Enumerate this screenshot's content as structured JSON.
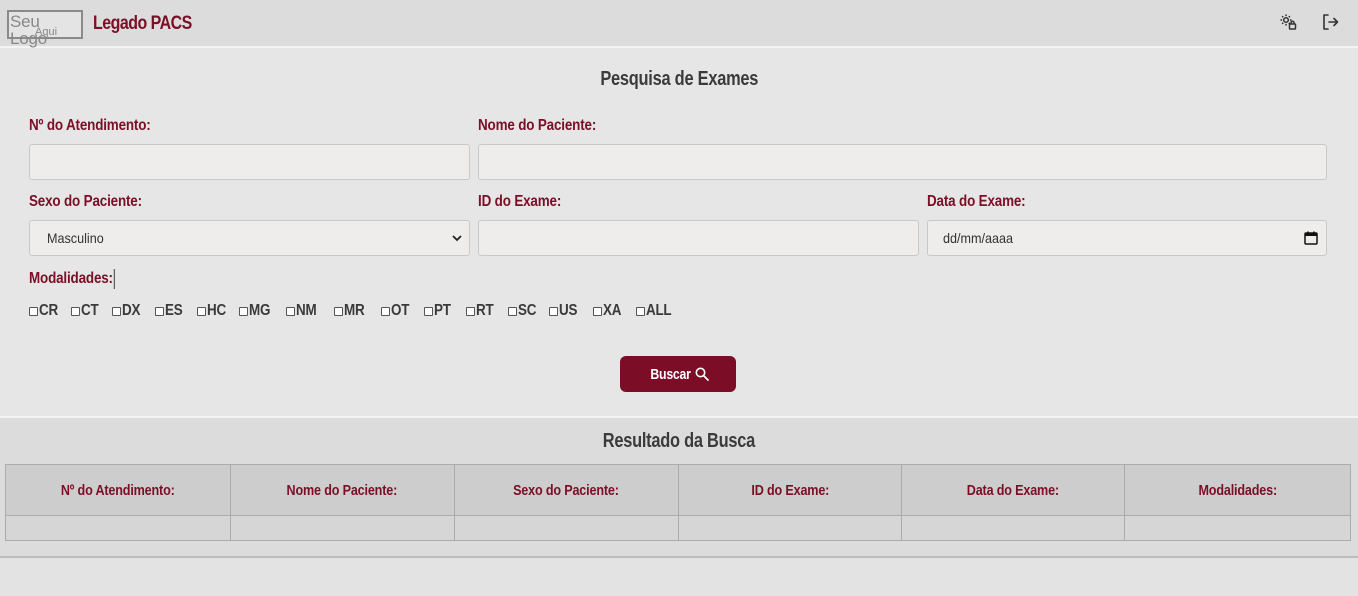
{
  "header": {
    "logo_line1": "Seu Logo",
    "logo_line2": "Aqui",
    "app_title": "Legado PACS",
    "settings_icon": "user-settings-icon",
    "logout_icon": "logout-icon"
  },
  "search": {
    "title": "Pesquisa de Exames",
    "atendimento_label": "Nº do Atendimento:",
    "atendimento_value": "",
    "nome_label": "Nome do Paciente:",
    "nome_value": "",
    "sexo_label": "Sexo do Paciente:",
    "sexo_selected": "Masculino",
    "id_label": "ID do Exame:",
    "id_value": "",
    "data_label": "Data do Exame:",
    "data_placeholder": "dd/mm/aaaa",
    "modalidades_label": "Modalidades:",
    "modalidades": [
      "CR",
      "CT",
      "DX",
      "ES",
      "HC",
      "MG",
      "NM",
      "MR",
      "OT",
      "PT",
      "RT",
      "SC",
      "US",
      "XA",
      "ALL"
    ],
    "button_label": "Buscar"
  },
  "results": {
    "title": "Resultado da Busca",
    "columns": [
      "Nº do Atendimento:",
      "Nome do Paciente:",
      "Sexo do Paciente:",
      "ID do Exame:",
      "Data do Exame:",
      "Modalidades:"
    ]
  },
  "colors": {
    "accent": "#7b0d27",
    "background": "#e6e6e6"
  }
}
